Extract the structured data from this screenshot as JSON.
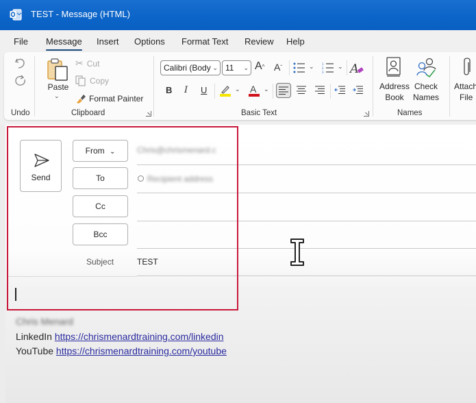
{
  "window": {
    "title": "TEST  -  Message (HTML)",
    "app_icon": "outlook-icon",
    "title_bar_color": "#0b64c8"
  },
  "menu": {
    "tabs": [
      {
        "label": "File",
        "active": false
      },
      {
        "label": "Message",
        "active": true
      },
      {
        "label": "Insert",
        "active": false
      },
      {
        "label": "Options",
        "active": false
      },
      {
        "label": "Format Text",
        "active": false
      },
      {
        "label": "Review",
        "active": false
      },
      {
        "label": "Help",
        "active": false
      }
    ]
  },
  "ribbon": {
    "undo_group": {
      "label": "Undo",
      "undo_icon": "undo-icon",
      "redo_icon": "redo-icon"
    },
    "clipboard_group": {
      "label": "Clipboard",
      "paste": "Paste",
      "cut": "Cut",
      "copy": "Copy",
      "format_painter": "Format Painter"
    },
    "basic_text_group": {
      "label": "Basic Text",
      "font_name": "Calibri (Body",
      "font_size": "11",
      "highlight_color": "#f5e600",
      "font_color": "#d0121b"
    },
    "names_group": {
      "label": "Names",
      "address_book_line1": "Address",
      "address_book_line2": "Book",
      "check_names_line1": "Check",
      "check_names_line2": "Names"
    },
    "attach_group": {
      "attach_line1": "Attach",
      "attach_line2": "File"
    }
  },
  "compose": {
    "send_label": "Send",
    "from_label": "From",
    "to_label": "To",
    "cc_label": "Cc",
    "bcc_label": "Bcc",
    "subject_label": "Subject",
    "from_value": "Chris@chrismenard.c",
    "to_value": "Recipient address",
    "cc_value": "",
    "bcc_value": "",
    "subject_value": "TEST",
    "highlight_color": "#c8173a"
  },
  "signature": {
    "name": "Chris Menard",
    "linkedin_label": "LinkedIn",
    "linkedin_url": "https://chrismenardtraining.com/linkedin",
    "youtube_label": "YouTube",
    "youtube_url": "https://chrismenardtraining.com/youtube"
  }
}
